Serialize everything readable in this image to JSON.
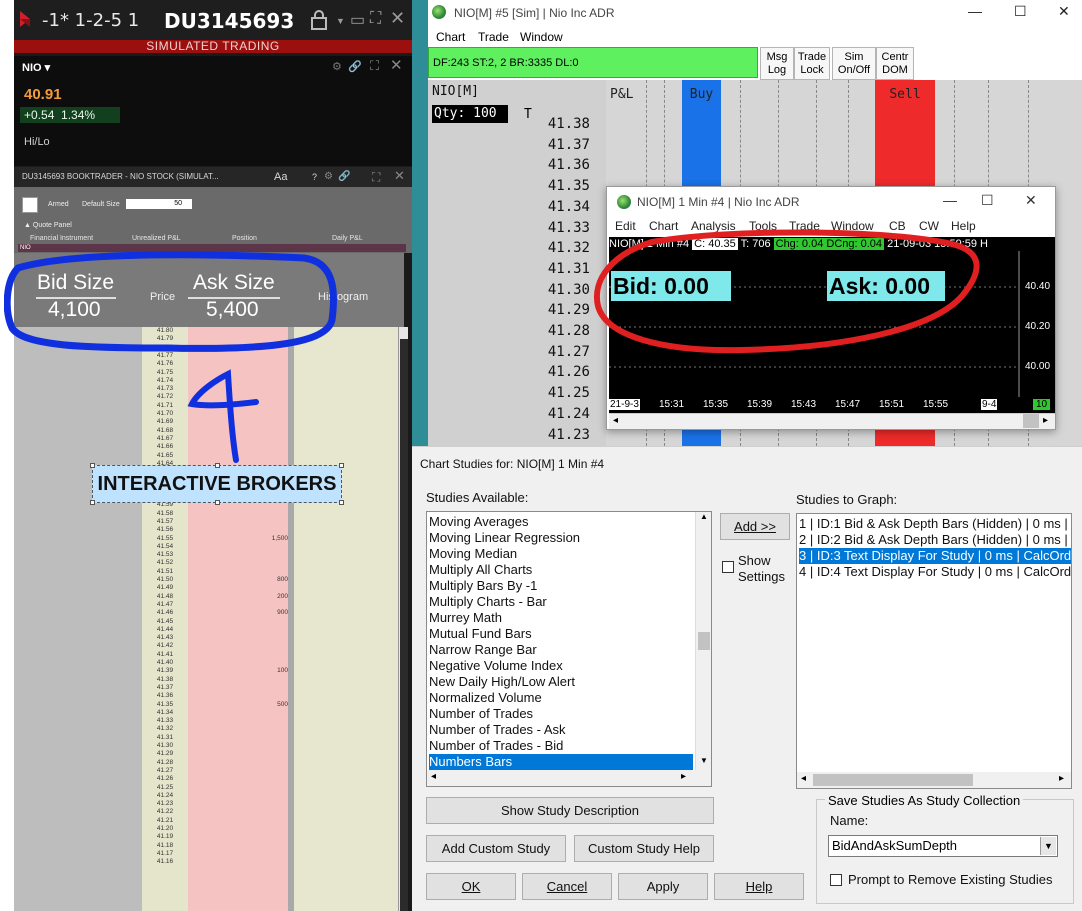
{
  "ib": {
    "account_numbers": "-1* 1-2-5 1",
    "account_id": "DU3145693",
    "sim_banner": "SIMULATED TRADING",
    "symbol": "NIO",
    "last": "40.91",
    "change": "+0.54",
    "change_pct": "1.34%",
    "hilo": "Hi/Lo",
    "booktrader_title": "DU3145693 BOOKTRADER - NIO STOCK (SIMULAT...",
    "font_btn": "Aa",
    "armed": "Armed",
    "default_size_label": "Default Size",
    "default_size_value": "50",
    "quote_panel": "Quote Panel",
    "col_financial": "Financial Instrument",
    "col_unrealized": "Unrealized P&L",
    "col_position": "Position",
    "col_daily": "Daily P&L",
    "nio_row": "NIO",
    "hdr_price": "Price",
    "hdr_histogram": "Histogram",
    "ladder_prices": [
      "41.80",
      "41.79",
      "41.78",
      "41.77",
      "41.76",
      "41.75",
      "41.74",
      "41.73",
      "41.72",
      "41.71",
      "41.70",
      "41.69",
      "41.68",
      "41.67",
      "41.66",
      "41.65",
      "41.64",
      "41.63",
      "41.62",
      "41.61",
      "41.60",
      "41.59",
      "41.58",
      "41.57",
      "41.56",
      "41.55",
      "41.54",
      "41.53",
      "41.52",
      "41.51",
      "41.50",
      "41.49",
      "41.48",
      "41.47",
      "41.46",
      "41.45",
      "41.44",
      "41.43",
      "41.42",
      "41.41",
      "41.40",
      "41.39",
      "41.38",
      "41.37",
      "41.36",
      "41.35",
      "41.34",
      "41.33",
      "41.32",
      "41.31",
      "41.30",
      "41.29",
      "41.28",
      "41.27",
      "41.26",
      "41.25",
      "41.24",
      "41.23",
      "41.22",
      "41.21",
      "41.20",
      "41.19",
      "41.18",
      "41.17",
      "41.16"
    ],
    "ladder_sizes": [
      {
        "price": "41.55",
        "size": "1,500"
      },
      {
        "price": "41.50",
        "size": "800"
      },
      {
        "price": "41.48",
        "size": "200"
      },
      {
        "price": "41.46",
        "size": "900"
      },
      {
        "price": "41.39",
        "size": "100"
      },
      {
        "price": "41.35",
        "size": "500"
      }
    ]
  },
  "annotations": {
    "bid_size_label": "Bid Size",
    "bid_size_value": "4,100",
    "ask_size_label": "Ask Size",
    "ask_size_value": "5,400",
    "interactive_brokers": "INTERACTIVE BROKERS"
  },
  "dom": {
    "title": "NIO[M]  #5 [Sim]  | Nio Inc ADR",
    "menu": [
      "Chart",
      "Trade",
      "Window"
    ],
    "status": "DF:243  ST:2, 2  BR:3335  DL:0",
    "toolbar": [
      {
        "l1": "Msg",
        "l2": "Log"
      },
      {
        "l1": "Trade",
        "l2": "Lock"
      },
      {
        "l1": "Sim",
        "l2": "On/Off"
      },
      {
        "l1": "Centr",
        "l2": "DOM"
      }
    ],
    "symbol": "NIO[M]",
    "qty": "Qty: 100",
    "t_label": "T",
    "hdr_pl": "P&L",
    "hdr_buy": "Buy",
    "hdr_sell": "Sell",
    "prices": [
      "41.38",
      "41.37",
      "41.36",
      "41.35",
      "41.34",
      "41.33",
      "41.32",
      "41.31",
      "41.30",
      "41.29",
      "41.28",
      "41.27",
      "41.26",
      "41.25",
      "41.24",
      "41.23"
    ]
  },
  "chart": {
    "title": "NIO[M]  1 Min  #4 | Nio Inc ADR",
    "menu": [
      "Edit",
      "Chart",
      "Analysis",
      "Tools",
      "Trade",
      "Window",
      "CB",
      "CW",
      "Help"
    ],
    "header_left": "NIO[M]  1 Min  #4 ",
    "header_c": "C: 40.35",
    "header_t": " T: 706 ",
    "header_chg": "Chg: 0.04 DCng: 0.04",
    "header_right": " 21-09-03 15:59:59 H",
    "bid": "Bid:  0.00",
    "ask": "Ask: 0.00",
    "y_labels": [
      "40.40",
      "40.20",
      "40.00"
    ],
    "x_labels": [
      "21-9-3",
      "15:31",
      "15:35",
      "15:39",
      "15:43",
      "15:47",
      "15:51",
      "15:55",
      "9-4",
      "10"
    ]
  },
  "studies": {
    "title": "Chart Studies for: NIO[M]  1 Min  #4",
    "available_label": "Studies Available:",
    "available": [
      "Moving Averages",
      "Moving Linear Regression",
      "Moving Median",
      "Multiply All Charts",
      "Multiply Bars By -1",
      "Multiply Charts - Bar",
      "Murrey Math",
      "Mutual Fund Bars",
      "Narrow Range Bar",
      "Negative Volume Index",
      "New Daily High/Low Alert",
      "Normalized Volume",
      "Number of Trades",
      "Number of Trades - Ask",
      "Number of Trades - Bid",
      "Numbers Bars"
    ],
    "available_selected": "Numbers Bars",
    "add_btn": "Add >>",
    "show_settings_1": "Show",
    "show_settings_2": "Settings",
    "to_graph_label": "Studies to Graph:",
    "to_graph": [
      "1 | ID:1  Bid & Ask Depth Bars (Hidden) | 0 ms |",
      "2 | ID:2  Bid & Ask Depth Bars (Hidden) | 0 ms |",
      "3 | ID:3  Text Display For Study | 0 ms | CalcOrd",
      "4 | ID:4  Text Display For Study | 0 ms | CalcOrd"
    ],
    "to_graph_selected": "3 | ID:3  Text Display For Study | 0 ms | CalcOrd",
    "show_desc": "Show Study Description",
    "add_custom": "Add Custom Study",
    "custom_help": "Custom Study Help",
    "ok": "OK",
    "cancel": "Cancel",
    "apply": "Apply",
    "help": "Help",
    "save_group": "Save Studies As Study Collection",
    "name_label": "Name:",
    "name_value": "BidAndAskSumDepth",
    "prompt_remove": "Prompt to Remove Existing Studies"
  }
}
